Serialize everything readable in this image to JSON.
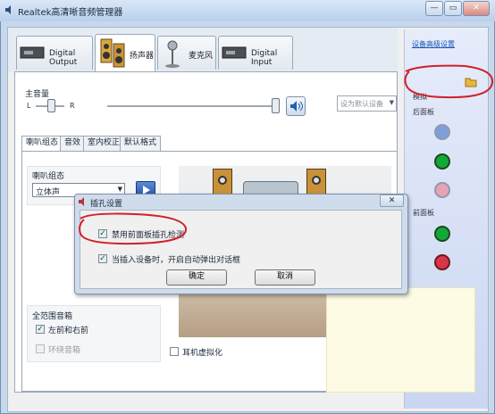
{
  "window": {
    "title": "Realtek高清晰音频管理器",
    "controls": {
      "minimize": "—",
      "maximize": "▭",
      "close": "✕"
    }
  },
  "device_tabs": [
    {
      "label": "Digital Output",
      "selected": false
    },
    {
      "label": "扬声器",
      "selected": true
    },
    {
      "label": "麦克风",
      "selected": false
    },
    {
      "label": "Digital Input",
      "selected": false
    }
  ],
  "volume": {
    "label": "主音量",
    "left": "L",
    "right": "R",
    "default_device": "设为默认设备"
  },
  "sub_tabs": [
    "喇叭组态",
    "音效",
    "室内校正",
    "默认格式"
  ],
  "speaker_config": {
    "label": "喇叭组态",
    "selected": "立体声"
  },
  "full_range": {
    "title": "全范围音箱",
    "front": "左前和右前",
    "surround": "环绕音箱"
  },
  "headphone_virtualization": "耳机虚拟化",
  "side_panel": {
    "advanced_link": "设备高级设置",
    "analog": "模拟",
    "back_panel": "后面板",
    "front_panel": "前面板"
  },
  "dialog": {
    "title": "插孔设置",
    "option_disable_front_detect": "禁用前面板插孔检测",
    "option_auto_popup": "当插入设备时，开启自动弹出对话框",
    "ok": "确定",
    "cancel": "取消"
  },
  "colors": {
    "annotation_red": "#d21f2a",
    "jack_blue": "#7f9ed8",
    "jack_green": "#12a83a",
    "jack_pink": "#e8a2b4",
    "jack_red": "#d8344a"
  }
}
